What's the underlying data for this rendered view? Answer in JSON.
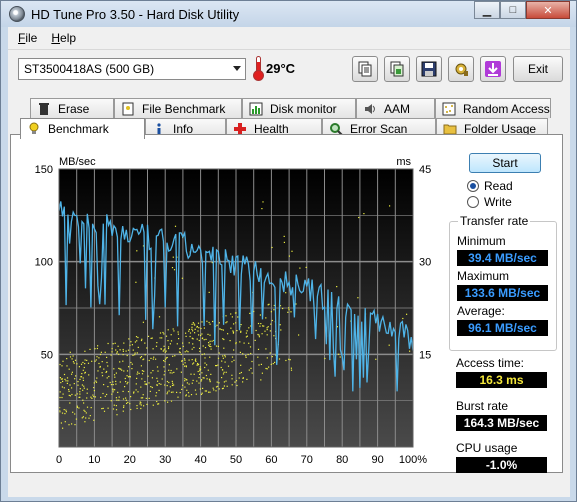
{
  "window": {
    "title": "HD Tune Pro 3.50 - Hard Disk Utility"
  },
  "menu": [
    {
      "label": "File",
      "accel": "F",
      "rest": "ile"
    },
    {
      "label": "Help",
      "accel": "H",
      "rest": "elp"
    }
  ],
  "toolbar": {
    "drive": "ST3500418AS (500 GB)",
    "temperature": "29°C",
    "buttons": [
      "copy-text-icon",
      "copy-image-icon",
      "save-icon",
      "options-icon",
      "download-icon"
    ],
    "exit_label": "Exit"
  },
  "tabs_top": [
    {
      "label": "Erase",
      "icon": "trash-icon"
    },
    {
      "label": "File Benchmark",
      "icon": "file-benchmark-icon"
    },
    {
      "label": "Disk monitor",
      "icon": "disk-monitor-icon"
    },
    {
      "label": "AAM",
      "icon": "speaker-icon"
    },
    {
      "label": "Random Access",
      "icon": "random-access-icon"
    }
  ],
  "tabs_bottom": [
    {
      "label": "Benchmark",
      "icon": "lightbulb-icon",
      "active": true
    },
    {
      "label": "Info",
      "icon": "info-icon"
    },
    {
      "label": "Health",
      "icon": "health-cross-icon"
    },
    {
      "label": "Error Scan",
      "icon": "magnifier-icon"
    },
    {
      "label": "Folder Usage",
      "icon": "folder-icon"
    }
  ],
  "controls": {
    "start_label": "Start",
    "read_label": "Read",
    "write_label": "Write",
    "selected": "Read"
  },
  "transfer_rate": {
    "title": "Transfer rate",
    "minimum_label": "Minimum",
    "minimum": "39.4 MB/sec",
    "maximum_label": "Maximum",
    "maximum": "133.6 MB/sec",
    "average_label": "Average:",
    "average": "96.1 MB/sec"
  },
  "access_time": {
    "label": "Access time:",
    "value": "16.3 ms"
  },
  "burst_rate": {
    "label": "Burst rate",
    "value": "164.3 MB/sec"
  },
  "cpu_usage": {
    "label": "CPU usage",
    "value": "-1.0%"
  },
  "colors": {
    "transfer_line": "#4fb4e8",
    "access_points": "#f0f040",
    "chart_bg": "#000000",
    "value_blue": "#3a9cff",
    "value_yellow": "#f5e83a"
  },
  "chart_data": {
    "type": "line",
    "left_unit": "MB/sec",
    "right_unit": "ms",
    "ylim": [
      0,
      150
    ],
    "y2lim": [
      0,
      45
    ],
    "yticks": [
      "150",
      "100",
      "50"
    ],
    "y2ticks": [
      "45",
      "30",
      "15"
    ],
    "xticks": [
      "0",
      "10",
      "20",
      "30",
      "40",
      "50",
      "60",
      "70",
      "80",
      "90",
      "100%"
    ],
    "xlim": [
      0,
      100
    ],
    "series": [
      {
        "kind": "transfer_rate",
        "x": [
          0,
          5,
          10,
          15,
          20,
          25,
          30,
          35,
          40,
          45,
          50,
          55,
          60,
          65,
          70,
          75,
          80,
          85,
          90,
          95,
          100
        ],
        "values": [
          128,
          124,
          120,
          118,
          115,
          113,
          111,
          109,
          105,
          101,
          99,
          96,
          92,
          88,
          85,
          80,
          77,
          73,
          69,
          63,
          59
        ]
      },
      {
        "kind": "access_time",
        "x_range": [
          0,
          70
        ],
        "values_ms_range": [
          3,
          24
        ]
      }
    ]
  }
}
